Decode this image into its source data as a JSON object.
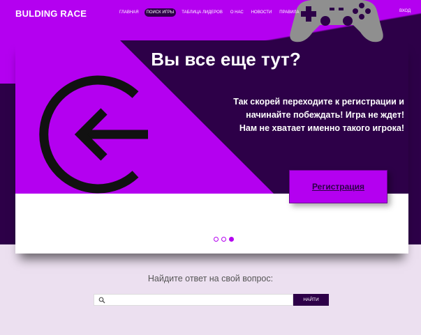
{
  "logo": "BULDING RACE",
  "nav": [
    {
      "label": "ГЛАВНАЯ",
      "active": false
    },
    {
      "label": "ПОИСК ИГРЫ",
      "active": true
    },
    {
      "label": "ТАБЛИЦА ЛИДЕРОВ",
      "active": false
    },
    {
      "label": "О НАС",
      "active": false
    },
    {
      "label": "НОВОСТИ",
      "active": false
    },
    {
      "label": "ПРАВИЛА",
      "active": false
    }
  ],
  "login_label": "ВХОД",
  "slide": {
    "title": "Вы все еще тут?",
    "text_lines": [
      "Так скорей переходите к регистрации и",
      "начинайте побеждать! Игра не ждет!",
      "Нам не хватает именно такого игрока!"
    ],
    "button_label": "Регистрация",
    "dots": 3,
    "active_dot": 3
  },
  "faq": {
    "heading": "Найдите ответ на свой вопрос:",
    "search_value": "",
    "search_placeholder": "",
    "button_label": "НАЙТИ"
  },
  "colors": {
    "accent": "#b400f0",
    "dark": "#2d0048",
    "page_bg": "#ece0f0"
  },
  "icons": [
    "gamepad-icon",
    "exit-icon",
    "search-icon"
  ]
}
